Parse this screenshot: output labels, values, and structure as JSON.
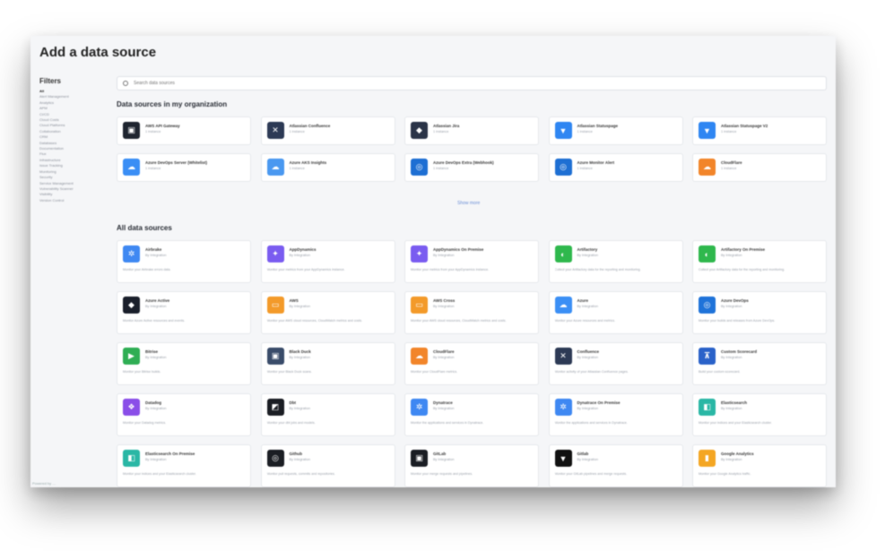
{
  "page": {
    "title": "Add a data source"
  },
  "filters": {
    "title": "Filters",
    "items": [
      "All",
      "Alert Management",
      "Analytics",
      "APM",
      "CI/CD",
      "Cloud Costs",
      "Cloud Platforms",
      "Collaboration",
      "CRM",
      "Databases",
      "Documentation",
      "Flux",
      "Infrastructure",
      "Issue Tracking",
      "Monitoring",
      "Security",
      "Service Management",
      "Vulnerability Scanner",
      "Visibility",
      "Version Control"
    ],
    "footer": "Powered by …"
  },
  "search": {
    "placeholder": "Search data sources"
  },
  "org_section": {
    "title": "Data sources in my organization",
    "show_more": "Show more",
    "cards": [
      {
        "name": "AWS API Gateway",
        "sub": "1 instance",
        "color": "#1f2530",
        "glyph": "▣"
      },
      {
        "name": "Atlassian Confluence",
        "sub": "1 instance",
        "color": "#2d3a55",
        "glyph": "✕"
      },
      {
        "name": "Atlassian Jira",
        "sub": "1 instance",
        "color": "#2b3448",
        "glyph": "◆"
      },
      {
        "name": "Atlassian Statuspage",
        "sub": "1 instance",
        "color": "#2f86f2",
        "glyph": "▼"
      },
      {
        "name": "Atlassian Statuspage V2",
        "sub": "1 instance",
        "color": "#2f86f2",
        "glyph": "▼"
      },
      {
        "name": "Azure DevOps Server (Whitelist)",
        "sub": "1 instance",
        "color": "#3a8ef5",
        "glyph": "☁"
      },
      {
        "name": "Azure AKS Insights",
        "sub": "1 instance",
        "color": "#4a98f0",
        "glyph": "☁"
      },
      {
        "name": "Azure DevOps Extra (Webhook)",
        "sub": "1 instance",
        "color": "#1e6fd3",
        "glyph": "◎"
      },
      {
        "name": "Azure Monitor Alert",
        "sub": "1 instance",
        "color": "#1e6fd3",
        "glyph": "◎"
      },
      {
        "name": "CloudFlare",
        "sub": "1 instance",
        "color": "#f2852a",
        "glyph": "☁"
      }
    ]
  },
  "all_section": {
    "title": "All data sources",
    "cards": [
      {
        "name": "Airbrake",
        "sub": "By Integration",
        "desc": "Monitor your Airbrake errors data.",
        "color": "#3f88f2",
        "glyph": "✲"
      },
      {
        "name": "AppDynamics",
        "sub": "By Integration",
        "desc": "Monitor your metrics from your AppDynamics instance.",
        "color": "#7a5cf0",
        "glyph": "✦"
      },
      {
        "name": "AppDynamics On Premise",
        "sub": "By Integration",
        "desc": "Monitor your metrics from your AppDynamics instance.",
        "color": "#7a5cf0",
        "glyph": "✦"
      },
      {
        "name": "Artifactory",
        "sub": "By Integration",
        "desc": "Collect your Artifactory data for the reporting and monitoring.",
        "color": "#2fb84d",
        "glyph": "◐"
      },
      {
        "name": "Artifactory On Premise",
        "sub": "By Integration",
        "desc": "Collect your Artifactory data for the reporting and monitoring.",
        "color": "#2fb84d",
        "glyph": "◐"
      },
      {
        "name": "Azure Active",
        "sub": "By Integration",
        "desc": "Monitor Azure Active resources and events.",
        "color": "#1a1f2b",
        "glyph": "◆"
      },
      {
        "name": "AWS",
        "sub": "By Integration",
        "desc": "Monitor your AWS cloud resources, CloudWatch metrics and costs.",
        "color": "#f39a2a",
        "glyph": "▭"
      },
      {
        "name": "AWS Cross",
        "sub": "By Integration",
        "desc": "Monitor your AWS cloud resources, CloudWatch metrics and costs.",
        "color": "#f39a2a",
        "glyph": "▭"
      },
      {
        "name": "Azure",
        "sub": "By Integration",
        "desc": "Monitor your Azure resources and metrics.",
        "color": "#3b8ff5",
        "glyph": "☁"
      },
      {
        "name": "Azure DevOps",
        "sub": "By Integration",
        "desc": "Monitor your builds and releases from Azure DevOps.",
        "color": "#1f73d9",
        "glyph": "◎"
      },
      {
        "name": "Bitrise",
        "sub": "By Integration",
        "desc": "Monitor your Bitrise builds.",
        "color": "#2fae54",
        "glyph": "▶"
      },
      {
        "name": "Black Duck",
        "sub": "By Integration",
        "desc": "Monitor your Black Duck scans.",
        "color": "#3a4c6a",
        "glyph": "▣"
      },
      {
        "name": "CloudFlare",
        "sub": "By Integration",
        "desc": "Monitor your CloudFlare metrics.",
        "color": "#f2852a",
        "glyph": "☁"
      },
      {
        "name": "Confluence",
        "sub": "By Integration",
        "desc": "Monitor activity of your Atlassian Confluence pages.",
        "color": "#2d3a55",
        "glyph": "✕"
      },
      {
        "name": "Custom Scorecard",
        "sub": "By Integration",
        "desc": "Build your custom scorecard.",
        "color": "#2a62c9",
        "glyph": "⊼"
      },
      {
        "name": "Datadog",
        "sub": "By Integration",
        "desc": "Monitor your Datadog metrics.",
        "color": "#8a4ee8",
        "glyph": "❖"
      },
      {
        "name": "Dbt",
        "sub": "By Integration",
        "desc": "Monitor your dbt jobs and models.",
        "color": "#1b1e24",
        "glyph": "◩"
      },
      {
        "name": "Dynatrace",
        "sub": "By Integration",
        "desc": "Monitor the applications and services in Dynatrace.",
        "color": "#3f88f2",
        "glyph": "✲"
      },
      {
        "name": "Dynatrace On Premise",
        "sub": "By Integration",
        "desc": "Monitor the applications and services in Dynatrace.",
        "color": "#3f88f2",
        "glyph": "✲"
      },
      {
        "name": "Elasticsearch",
        "sub": "By Integration",
        "desc": "Monitor your indices and your Elasticsearch cluster.",
        "color": "#2ab7a5",
        "glyph": "◧"
      },
      {
        "name": "Elasticsearch On Premise",
        "sub": "By Integration",
        "desc": "Monitor your indices and your Elasticsearch cluster.",
        "color": "#2ab7a5",
        "glyph": "◧"
      },
      {
        "name": "Github",
        "sub": "By Integration",
        "desc": "Monitor pull requests, commits and repositories.",
        "color": "#1b1e24",
        "glyph": "◎"
      },
      {
        "name": "GitLab",
        "sub": "By Integration",
        "desc": "Monitor your merge requests and pipelines.",
        "color": "#1b1e24",
        "glyph": "▣"
      },
      {
        "name": "Gitlab",
        "sub": "By Integration",
        "desc": "Monitor your GitLab pipelines and merge requests.",
        "color": "#111111",
        "glyph": "▼"
      },
      {
        "name": "Google Analytics",
        "sub": "By Integration",
        "desc": "Monitor your Google Analytics traffic.",
        "color": "#f4a623",
        "glyph": "▮"
      }
    ]
  }
}
